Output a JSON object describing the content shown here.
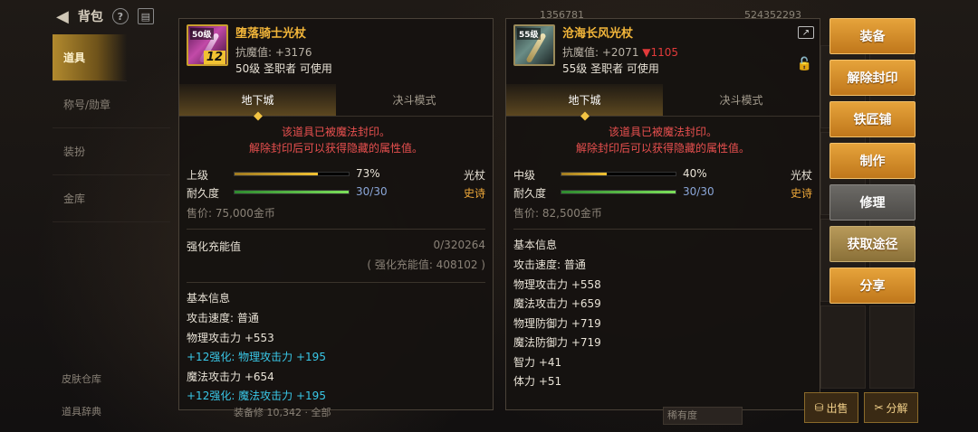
{
  "topbar": {
    "title": "背包",
    "currency_1": "1356781",
    "currency_2": "524352293"
  },
  "leftnav": {
    "items": [
      {
        "label": "道具",
        "active": true
      },
      {
        "label": "称号/勋章",
        "active": false
      },
      {
        "label": "装扮",
        "active": false
      },
      {
        "label": "金库",
        "active": false
      }
    ],
    "bottom": [
      "皮肤仓库",
      "道具辞典"
    ]
  },
  "panel1": {
    "name": "堕落骑士光杖",
    "stat": "抗魔值: +3176",
    "requirement": "50级 圣职者 可使用",
    "icon_level": "50级",
    "enhance_badge": "12",
    "tabs": [
      "地下城",
      "决斗模式"
    ],
    "seal_line1": "该道具已被魔法封印。",
    "seal_line2": "解除封印后可以获得隐藏的属性值。",
    "grade_label": "上级",
    "grade_value": "73%",
    "grade_fraction": 0.73,
    "durability_label": "耐久度",
    "durability_value": "30/30",
    "durability_fraction": 1.0,
    "type": "光杖",
    "rarity": "史诗",
    "price": "售价: 75,000金币",
    "refine_label": "强化充能值",
    "refine_value": "0/320264",
    "refine_total": "( 强化充能值: 408102 )",
    "basic_title": "基本信息",
    "stats": [
      {
        "text": "攻击速度: 普通",
        "highlight": false
      },
      {
        "text": "物理攻击力 +553",
        "highlight": false
      },
      {
        "text": "+12强化: 物理攻击力 +195",
        "highlight": true
      },
      {
        "text": "魔法攻击力 +654",
        "highlight": false
      },
      {
        "text": "+12强化: 魔法攻击力 +195",
        "highlight": true
      }
    ]
  },
  "panel2": {
    "name": "沧海长风光杖",
    "stat_prefix": "抗魔值: +2071",
    "stat_down": "▼1105",
    "requirement": "55级 圣职者 可使用",
    "icon_level": "55级",
    "tabs": [
      "地下城",
      "决斗模式"
    ],
    "seal_line1": "该道具已被魔法封印。",
    "seal_line2": "解除封印后可以获得隐藏的属性值。",
    "grade_label": "中级",
    "grade_value": "40%",
    "grade_fraction": 0.4,
    "durability_label": "耐久度",
    "durability_value": "30/30",
    "durability_fraction": 1.0,
    "type": "光杖",
    "rarity": "史诗",
    "price": "售价: 82,500金币",
    "basic_title": "基本信息",
    "stats": [
      {
        "text": "攻击速度: 普通",
        "highlight": false
      },
      {
        "text": "物理攻击力 +558",
        "highlight": false
      },
      {
        "text": "魔法攻击力 +659",
        "highlight": false
      },
      {
        "text": "物理防御力 +719",
        "highlight": false
      },
      {
        "text": "魔法防御力 +719",
        "highlight": false
      },
      {
        "text": "智力 +41",
        "highlight": false
      },
      {
        "text": "体力 +51",
        "highlight": false
      }
    ]
  },
  "actions": [
    {
      "label": "装备",
      "style": "gold"
    },
    {
      "label": "解除封印",
      "style": "gold"
    },
    {
      "label": "铁匠铺",
      "style": "gold"
    },
    {
      "label": "制作",
      "style": "gold"
    },
    {
      "label": "修理",
      "style": "grey"
    },
    {
      "label": "获取途径",
      "style": "muted"
    },
    {
      "label": "分享",
      "style": "gold"
    }
  ],
  "bottom": {
    "sell_label": "出售",
    "disassemble_label": "分解",
    "left_text": "装备修 10,342 · 全部",
    "select_value": "稀有度"
  },
  "colors": {
    "accent_gold": "#f3b63a",
    "seal_red": "#e9504f",
    "enhance_cyan": "#39c8e8",
    "down_red": "#e23a3a"
  }
}
